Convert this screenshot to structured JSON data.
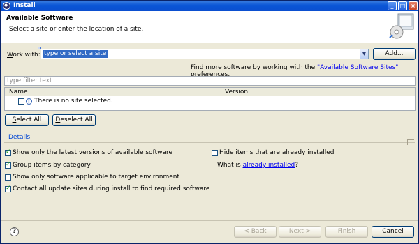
{
  "window": {
    "title": "Install"
  },
  "header": {
    "title": "Available Software",
    "subtitle": "Select a site or enter the location of a site."
  },
  "work_with": {
    "label_prefix": "W",
    "label_rest": "ork with:",
    "value": "type or select a site",
    "add_button": "Add..."
  },
  "find_more": {
    "text_before": "Find more software by working with the ",
    "link": "\"Available Software Sites\"",
    "text_after": " preferences."
  },
  "filter": {
    "placeholder": "type filter text"
  },
  "table": {
    "columns": [
      "Name",
      "Version"
    ],
    "empty_message": "There is no site selected."
  },
  "buttons": {
    "select_all": "Select All",
    "deselect_all": "Deselect All"
  },
  "details": {
    "label": "Details"
  },
  "options": {
    "latest_versions": {
      "label": "Show only the latest versions of available software",
      "checked": true
    },
    "group_by_category": {
      "label": "Group items by category",
      "checked": true
    },
    "applicable_only": {
      "label": "Show only software applicable to target environment",
      "checked": false
    },
    "contact_sites": {
      "label": "Contact all update sites during install to find required software",
      "checked": true
    },
    "hide_installed": {
      "label": "Hide items that are already installed",
      "checked": false
    }
  },
  "already_installed": {
    "text_before": "What is ",
    "link": "already installed",
    "text_after": "?"
  },
  "footer": {
    "back": "< Back",
    "next": "Next >",
    "finish": "Finish",
    "cancel": "Cancel"
  },
  "colors": {
    "titlebar": "#0a55d6",
    "link": "#0000ee",
    "selection": "#316ac5",
    "details": "#0046d5"
  }
}
